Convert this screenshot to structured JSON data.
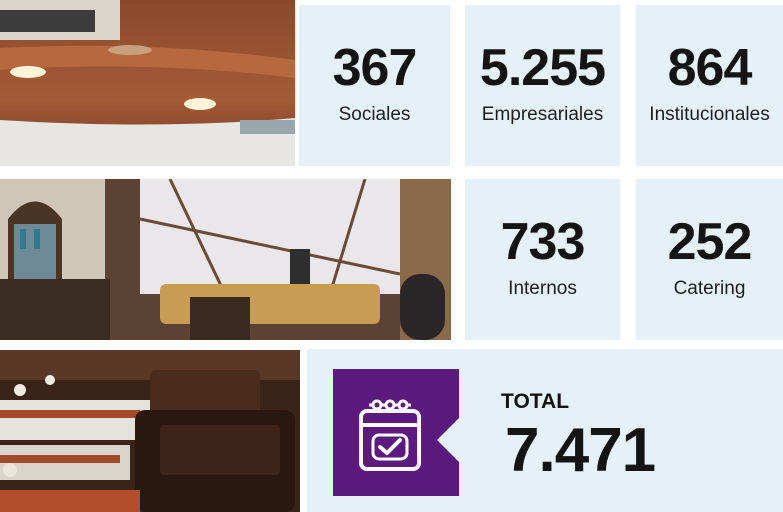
{
  "stats": [
    {
      "value": "367",
      "label": "Sociales"
    },
    {
      "value": "5.255",
      "label": "Empresariales"
    },
    {
      "value": "864",
      "label": "Institucionales"
    },
    {
      "value": "733",
      "label": "Internos"
    },
    {
      "value": "252",
      "label": "Catering"
    }
  ],
  "total": {
    "label": "TOTAL",
    "value": "7.471"
  },
  "icons": {
    "calendar": "calendar-check-icon"
  },
  "colors": {
    "card_background": "#e6f0f7",
    "accent_purple": "#5c1a7e",
    "text": "#141414"
  }
}
